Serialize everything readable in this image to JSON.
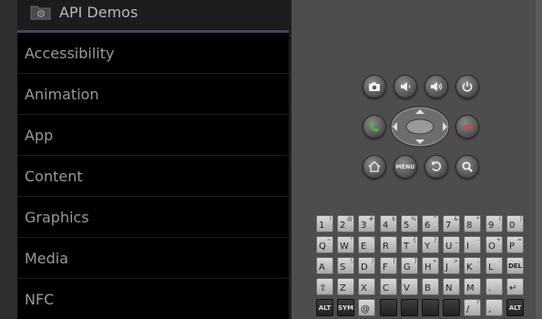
{
  "app": {
    "title": "API Demos",
    "icon": "folder-gear-icon"
  },
  "list": {
    "items": [
      {
        "label": "Accessibility"
      },
      {
        "label": "Animation"
      },
      {
        "label": "App"
      },
      {
        "label": "Content"
      },
      {
        "label": "Graphics"
      },
      {
        "label": "Media"
      },
      {
        "label": "NFC"
      }
    ]
  },
  "controls": {
    "top_row": [
      "camera-icon",
      "volume-down-icon",
      "volume-up-icon",
      "power-icon"
    ],
    "call_buttons": [
      "call-icon",
      "end-call-icon"
    ],
    "bottom_row": [
      "home-icon",
      "menu-button",
      "back-icon",
      "search-icon"
    ],
    "menu_label": "MENU"
  },
  "keyboard": {
    "row1": [
      {
        "main": "1",
        "alt": "!"
      },
      {
        "main": "2",
        "alt": "@"
      },
      {
        "main": "3",
        "alt": "#"
      },
      {
        "main": "4",
        "alt": "$"
      },
      {
        "main": "5",
        "alt": "%"
      },
      {
        "main": "6",
        "alt": "^"
      },
      {
        "main": "7",
        "alt": "&"
      },
      {
        "main": "8",
        "alt": "*"
      },
      {
        "main": "9",
        "alt": "("
      },
      {
        "main": "0",
        "alt": ")"
      }
    ],
    "row2": [
      {
        "main": "Q",
        "alt": "~"
      },
      {
        "main": "W",
        "alt": "\""
      },
      {
        "main": "E",
        "alt": "'"
      },
      {
        "main": "R",
        "alt": "`"
      },
      {
        "main": "T",
        "alt": "{"
      },
      {
        "main": "Y",
        "alt": "}"
      },
      {
        "main": "U",
        "alt": "_"
      },
      {
        "main": "I",
        "alt": "-"
      },
      {
        "main": "O",
        "alt": "+"
      },
      {
        "main": "P",
        "alt": "="
      }
    ],
    "row3": [
      {
        "main": "A",
        "alt": ""
      },
      {
        "main": "S",
        "alt": "\\"
      },
      {
        "main": "D",
        "alt": "|"
      },
      {
        "main": "F",
        "alt": "["
      },
      {
        "main": "G",
        "alt": "]"
      },
      {
        "main": "H",
        "alt": "<"
      },
      {
        "main": "J",
        "alt": ">"
      },
      {
        "main": "K",
        "alt": ";"
      },
      {
        "main": "L",
        "alt": ":"
      },
      {
        "main": "DEL",
        "alt": ""
      }
    ],
    "row4": [
      {
        "main": "⇧",
        "alt": ""
      },
      {
        "main": "Z",
        "alt": ""
      },
      {
        "main": "X",
        "alt": ""
      },
      {
        "main": "C",
        "alt": ""
      },
      {
        "main": "V",
        "alt": ""
      },
      {
        "main": "B",
        "alt": ""
      },
      {
        "main": "N",
        "alt": ""
      },
      {
        "main": "M",
        "alt": ""
      },
      {
        "main": ".",
        "alt": ""
      },
      {
        "main": "↵",
        "alt": ""
      }
    ],
    "row5": [
      {
        "main": "ALT",
        "alt": ""
      },
      {
        "main": "SYM",
        "alt": ""
      },
      {
        "main": "@",
        "alt": ""
      },
      {
        "main": "",
        "alt": ""
      },
      {
        "main": "",
        "alt": ""
      },
      {
        "main": "",
        "alt": ""
      },
      {
        "main": "",
        "alt": ""
      },
      {
        "main": "/",
        "alt": "?"
      },
      {
        "main": ",",
        "alt": ""
      },
      {
        "main": "ALT",
        "alt": ""
      }
    ]
  }
}
